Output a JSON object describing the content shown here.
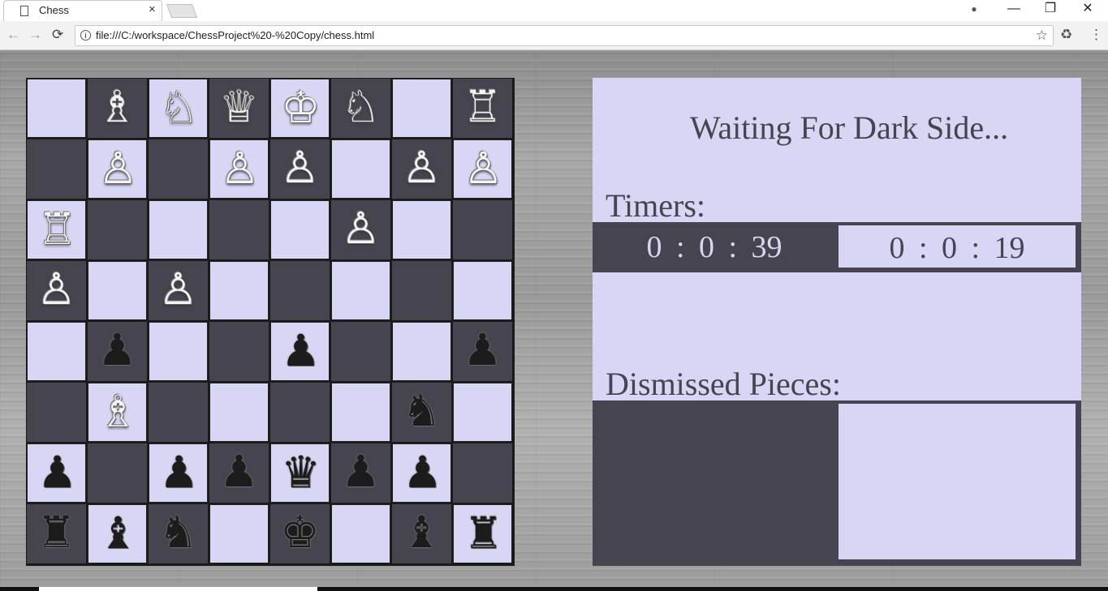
{
  "browser": {
    "tab_title": "Chess",
    "tab_close": "×",
    "url": "file:///C:/workspace/ChessProject%20-%20Copy/chess.html",
    "window_controls": {
      "minimize": "—",
      "restore": "❐",
      "close": "✕"
    },
    "nav": {
      "back": "←",
      "forward": "→",
      "reload": "⟳",
      "star": "☆",
      "menu": "⋮",
      "extension": "♻",
      "account": "●"
    }
  },
  "board": {
    "colors": {
      "light": "#d8d6f5",
      "dark": "#46444f"
    },
    "rows": [
      [
        {
          "c": "light",
          "p": ""
        },
        {
          "c": "dark",
          "p": "♗",
          "s": "white"
        },
        {
          "c": "light",
          "p": "♘",
          "s": "white"
        },
        {
          "c": "dark",
          "p": "♕",
          "s": "white"
        },
        {
          "c": "light",
          "p": "♔",
          "s": "white"
        },
        {
          "c": "dark",
          "p": "♘",
          "s": "white"
        },
        {
          "c": "light",
          "p": ""
        },
        {
          "c": "dark",
          "p": "♖",
          "s": "white"
        }
      ],
      [
        {
          "c": "dark",
          "p": ""
        },
        {
          "c": "light",
          "p": "♙",
          "s": "white"
        },
        {
          "c": "dark",
          "p": ""
        },
        {
          "c": "light",
          "p": "♙",
          "s": "white"
        },
        {
          "c": "dark",
          "p": "♙",
          "s": "white"
        },
        {
          "c": "light",
          "p": ""
        },
        {
          "c": "dark",
          "p": "♙",
          "s": "white"
        },
        {
          "c": "light",
          "p": "♙",
          "s": "white"
        }
      ],
      [
        {
          "c": "light",
          "p": "♖",
          "s": "white"
        },
        {
          "c": "dark",
          "p": ""
        },
        {
          "c": "light",
          "p": ""
        },
        {
          "c": "dark",
          "p": ""
        },
        {
          "c": "light",
          "p": ""
        },
        {
          "c": "dark",
          "p": "♙",
          "s": "white"
        },
        {
          "c": "light",
          "p": ""
        },
        {
          "c": "dark",
          "p": ""
        }
      ],
      [
        {
          "c": "dark",
          "p": "♙",
          "s": "white"
        },
        {
          "c": "light",
          "p": ""
        },
        {
          "c": "dark",
          "p": "♙",
          "s": "white"
        },
        {
          "c": "light",
          "p": ""
        },
        {
          "c": "dark",
          "p": ""
        },
        {
          "c": "light",
          "p": ""
        },
        {
          "c": "dark",
          "p": ""
        },
        {
          "c": "light",
          "p": ""
        }
      ],
      [
        {
          "c": "light",
          "p": ""
        },
        {
          "c": "dark",
          "p": "♟",
          "s": "black"
        },
        {
          "c": "light",
          "p": ""
        },
        {
          "c": "dark",
          "p": ""
        },
        {
          "c": "light",
          "p": "♟",
          "s": "black"
        },
        {
          "c": "dark",
          "p": ""
        },
        {
          "c": "light",
          "p": ""
        },
        {
          "c": "dark",
          "p": "♟",
          "s": "black"
        }
      ],
      [
        {
          "c": "dark",
          "p": ""
        },
        {
          "c": "light",
          "p": "♗",
          "s": "white"
        },
        {
          "c": "dark",
          "p": ""
        },
        {
          "c": "light",
          "p": ""
        },
        {
          "c": "dark",
          "p": ""
        },
        {
          "c": "light",
          "p": ""
        },
        {
          "c": "dark",
          "p": "♞",
          "s": "black"
        },
        {
          "c": "light",
          "p": ""
        }
      ],
      [
        {
          "c": "light",
          "p": "♟",
          "s": "black"
        },
        {
          "c": "dark",
          "p": ""
        },
        {
          "c": "light",
          "p": "♟",
          "s": "black"
        },
        {
          "c": "dark",
          "p": "♟",
          "s": "black"
        },
        {
          "c": "light",
          "p": "♛",
          "s": "black"
        },
        {
          "c": "dark",
          "p": "♟",
          "s": "black"
        },
        {
          "c": "light",
          "p": "♟",
          "s": "black"
        },
        {
          "c": "dark",
          "p": ""
        }
      ],
      [
        {
          "c": "dark",
          "p": "♜",
          "s": "black"
        },
        {
          "c": "light",
          "p": "♝",
          "s": "black"
        },
        {
          "c": "dark",
          "p": "♞",
          "s": "black"
        },
        {
          "c": "light",
          "p": ""
        },
        {
          "c": "dark",
          "p": "♚",
          "s": "black"
        },
        {
          "c": "light",
          "p": ""
        },
        {
          "c": "dark",
          "p": "♝",
          "s": "black"
        },
        {
          "c": "light",
          "p": "♜",
          "s": "black"
        }
      ]
    ]
  },
  "panel": {
    "status": "Waiting For Dark Side...",
    "timers_label": "Timers:",
    "timer_light": "0 : 0 : 39",
    "timer_dark": "0 : 0 : 19",
    "dismissed_label": "Dismissed Pieces:"
  }
}
